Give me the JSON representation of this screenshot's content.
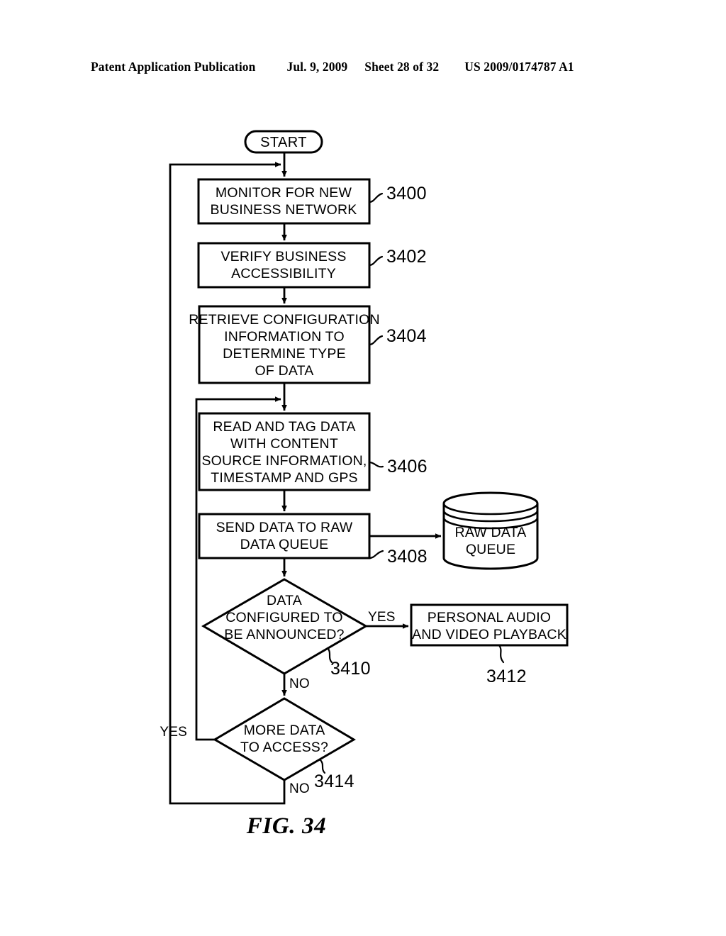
{
  "header": {
    "publication": "Patent Application Publication",
    "date": "Jul. 9, 2009",
    "sheet": "Sheet 28 of 32",
    "patent_number": "US 2009/0174787 A1"
  },
  "figure": {
    "caption": "FIG. 34",
    "terminal_start": "START",
    "nodes": [
      {
        "id": "3400",
        "type": "process",
        "ref": "3400",
        "lines": [
          "MONITOR FOR NEW",
          "BUSINESS NETWORK"
        ]
      },
      {
        "id": "3402",
        "type": "process",
        "ref": "3402",
        "lines": [
          "VERIFY BUSINESS",
          "ACCESSIBILITY"
        ]
      },
      {
        "id": "3404",
        "type": "process",
        "ref": "3404",
        "lines": [
          "RETRIEVE CONFIGURATION",
          "INFORMATION TO",
          "DETERMINE TYPE",
          "OF DATA"
        ]
      },
      {
        "id": "3406",
        "type": "process",
        "ref": "3406",
        "lines": [
          "READ AND TAG DATA",
          "WITH CONTENT",
          "SOURCE INFORMATION,",
          "TIMESTAMP AND GPS"
        ]
      },
      {
        "id": "3408",
        "type": "process",
        "ref": "3408",
        "lines": [
          "SEND DATA TO RAW",
          "DATA QUEUE"
        ]
      },
      {
        "id": "3410",
        "type": "decision",
        "ref": "3410",
        "lines": [
          "DATA",
          "CONFIGURED TO",
          "BE ANNOUNCED?"
        ]
      },
      {
        "id": "3412",
        "type": "process",
        "ref": "3412",
        "lines": [
          "PERSONAL AUDIO",
          "AND VIDEO PLAYBACK"
        ]
      },
      {
        "id": "3414",
        "type": "decision",
        "ref": "3414",
        "lines": [
          "MORE DATA",
          "TO ACCESS?"
        ]
      },
      {
        "id": "raw-data-queue",
        "type": "database",
        "ref": "",
        "lines": [
          "RAW DATA",
          "QUEUE"
        ]
      }
    ],
    "branch_labels": {
      "d3410_yes": "YES",
      "d3410_no": "NO",
      "d3414_yes": "YES",
      "d3414_no": "NO"
    }
  },
  "colors": {
    "ink": "#000000",
    "paper": "#ffffff"
  }
}
